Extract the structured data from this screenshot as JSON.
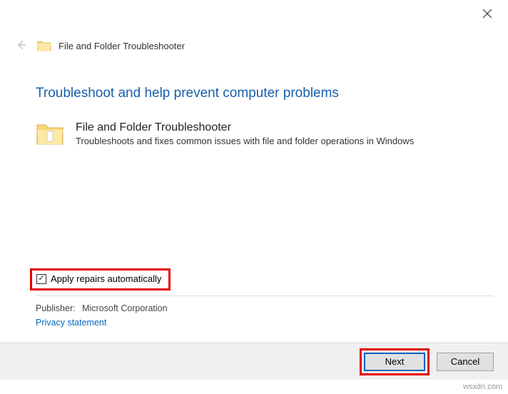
{
  "window": {
    "title": "File and Folder Troubleshooter"
  },
  "page": {
    "title": "Troubleshoot and help prevent computer problems"
  },
  "item": {
    "title": "File and Folder Troubleshooter",
    "description": "Troubleshoots and fixes common issues with file and folder operations in Windows"
  },
  "apply": {
    "label": "Apply repairs automatically"
  },
  "publisher": {
    "label": "Publisher:",
    "value": "Microsoft Corporation"
  },
  "privacy": {
    "label": "Privacy statement"
  },
  "buttons": {
    "next": "Next",
    "cancel": "Cancel"
  },
  "watermark": "wsxdn.com"
}
